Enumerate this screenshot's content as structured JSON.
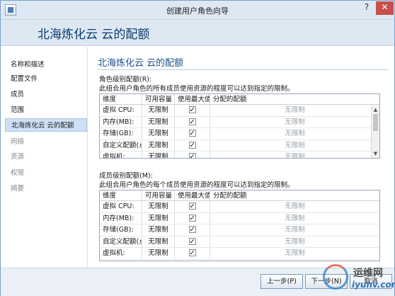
{
  "window": {
    "title": "创建用户角色向导",
    "help_glyph": "?",
    "close_glyph": "✕"
  },
  "header": {
    "title": "北海炼化云 云的配额"
  },
  "nav": {
    "items": [
      {
        "label": "名称和描述",
        "state": "normal"
      },
      {
        "label": "配置文件",
        "state": "normal"
      },
      {
        "label": "成员",
        "state": "normal"
      },
      {
        "label": "范围",
        "state": "normal"
      },
      {
        "label": "北海炼化云 云的配额",
        "state": "active"
      },
      {
        "label": "网络",
        "state": "disabled"
      },
      {
        "label": "资源",
        "state": "disabled"
      },
      {
        "label": "权限",
        "state": "disabled"
      },
      {
        "label": "摘要",
        "state": "disabled"
      }
    ]
  },
  "main": {
    "title": "北海炼化云 云的配额",
    "role_section": {
      "label": "角色级别配额(R):",
      "description": "此组合用户角色的所有成员使用资源的程度可以达到指定的限制。",
      "columns": [
        "维度",
        "可用容量",
        "使用最大值",
        "分配的配额"
      ],
      "rows": [
        {
          "dimension": "虚拟 CPU:",
          "available": "无限制",
          "use_max": true,
          "allocated": "无限制"
        },
        {
          "dimension": "内存(MB):",
          "available": "无限制",
          "use_max": true,
          "allocated": "无限制"
        },
        {
          "dimension": "存储(GB):",
          "available": "无限制",
          "use_max": true,
          "allocated": "无限制"
        },
        {
          "dimension": "自定义配额(点):",
          "available": "无限制",
          "use_max": true,
          "allocated": "无限制"
        },
        {
          "dimension": "虚拟机:",
          "available": "无限制",
          "use_max": true,
          "allocated": "无限制"
        }
      ]
    },
    "member_section": {
      "label": "成员级别配额(M):",
      "description": "此组合用户角色的每个成员使用资源的程度可以达到指定的限制。",
      "columns": [
        "维度",
        "可用容量",
        "使用最大值",
        "分配的配额"
      ],
      "rows": [
        {
          "dimension": "虚拟 CPU:",
          "available": "无限制",
          "use_max": true,
          "allocated": "无限制"
        },
        {
          "dimension": "内存(MB):",
          "available": "无限制",
          "use_max": true,
          "allocated": "无限制"
        },
        {
          "dimension": "存储(GB):",
          "available": "无限制",
          "use_max": true,
          "allocated": "无限制"
        },
        {
          "dimension": "自定义配额(点):",
          "available": "无限制",
          "use_max": true,
          "allocated": "无限制"
        },
        {
          "dimension": "虚拟机:",
          "available": "无限制",
          "use_max": true,
          "allocated": "无限制"
        }
      ]
    }
  },
  "footer": {
    "prev_label": "上一步(P)",
    "next_label": "下一步(N)",
    "cancel_label": "取消"
  },
  "watermark": {
    "cn": "运维网",
    "en": "iyunv.com"
  },
  "colors": {
    "accent": "#1b4f8a",
    "header_bg": "#dde8f3",
    "nav_active_bg": "#cfe0f5"
  }
}
